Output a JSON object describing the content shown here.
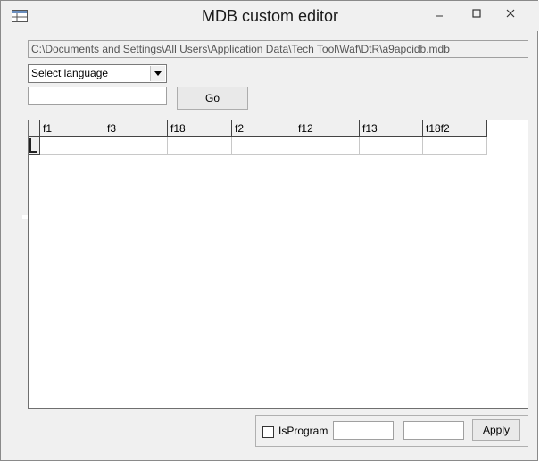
{
  "window": {
    "title": "MDB custom editor"
  },
  "path": {
    "value": "C:\\Documents and Settings\\All Users\\Application Data\\Tech Tool\\Waf\\DtR\\a9apcidb.mdb"
  },
  "language": {
    "selected": "Select language"
  },
  "search": {
    "value": ""
  },
  "go": {
    "label": "Go"
  },
  "grid": {
    "columns": [
      "f1",
      "f3",
      "f18",
      "f2",
      "f12",
      "f13",
      "t18f2"
    ],
    "rows": [
      [
        "",
        "",
        "",
        "",
        "",
        "",
        ""
      ]
    ]
  },
  "bottom": {
    "isprogram_label": "IsProgram",
    "isprogram_checked": false,
    "input1": "",
    "input2": "",
    "apply_label": "Apply"
  }
}
